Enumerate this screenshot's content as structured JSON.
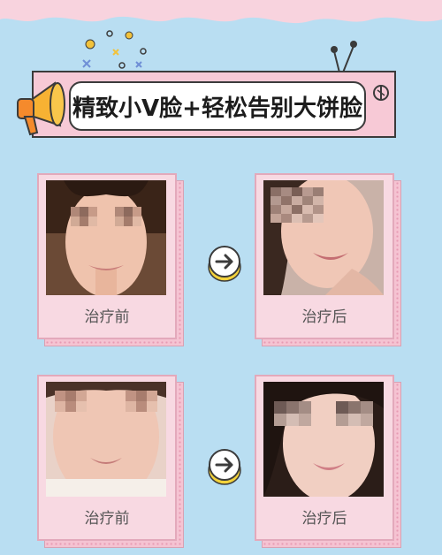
{
  "banner": {
    "title": "精致小V脸+轻松告别大饼脸"
  },
  "cases": [
    {
      "before_label": "治疗前",
      "after_label": "治疗后"
    },
    {
      "before_label": "治疗前",
      "after_label": "治疗后"
    }
  ],
  "colors": {
    "background": "#b9def2",
    "accent_pink": "#f7c9d6",
    "arrow_yellow": "#f3d23b"
  },
  "icons": [
    "megaphone-icon",
    "arrow-right-icon",
    "antenna-icon",
    "star-confetti-icon"
  ]
}
